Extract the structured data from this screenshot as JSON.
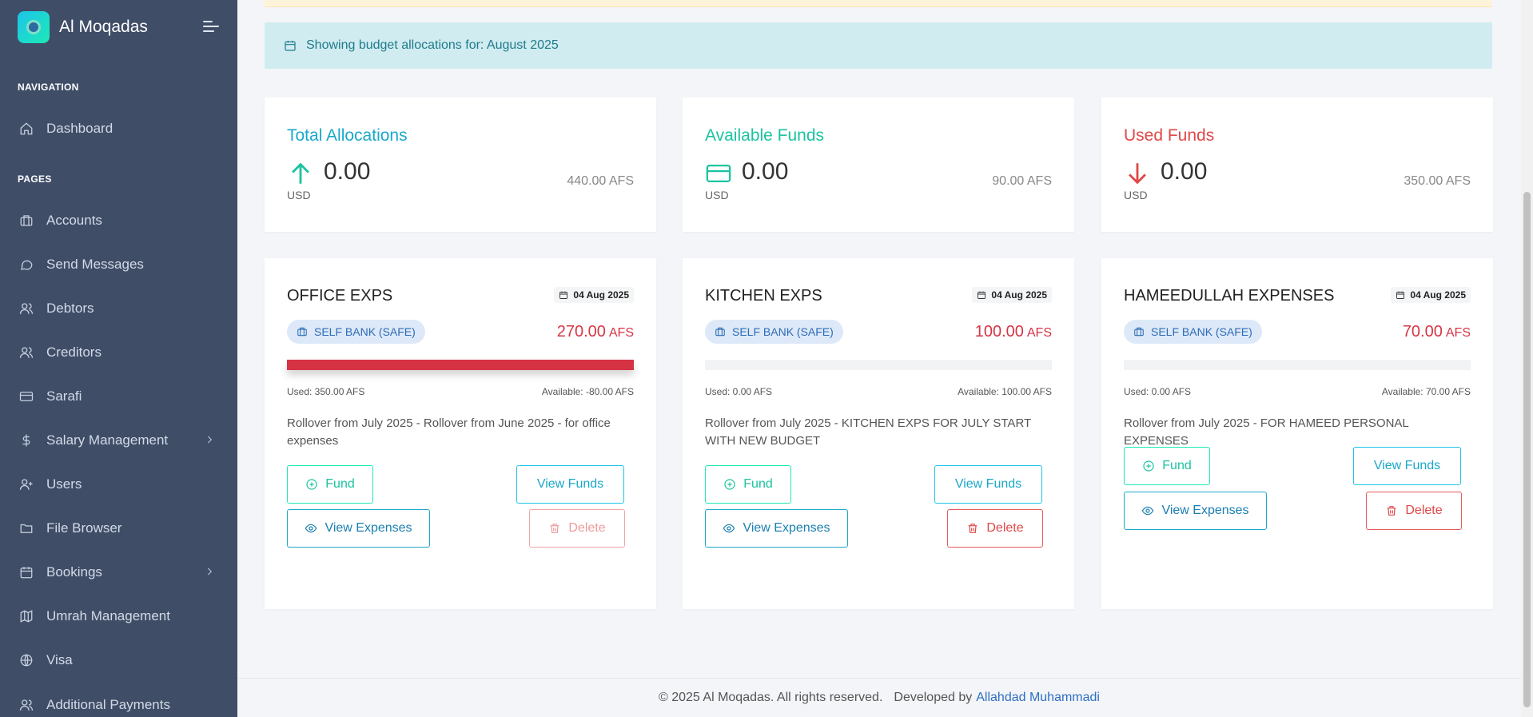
{
  "brand": {
    "name": "Al Moqadas"
  },
  "sidebar": {
    "captions": {
      "navigation": "NAVIGATION",
      "pages": "PAGES"
    },
    "items": [
      {
        "label": "Dashboard",
        "icon": "home-icon"
      },
      {
        "label": "Accounts",
        "icon": "briefcase-icon"
      },
      {
        "label": "Send Messages",
        "icon": "message-icon"
      },
      {
        "label": "Debtors",
        "icon": "users-icon"
      },
      {
        "label": "Creditors",
        "icon": "users-icon"
      },
      {
        "label": "Sarafi",
        "icon": "credit-card-icon"
      },
      {
        "label": "Salary Management",
        "icon": "dollar-icon",
        "submenu": true
      },
      {
        "label": "Users",
        "icon": "user-plus-icon"
      },
      {
        "label": "File Browser",
        "icon": "folder-icon"
      },
      {
        "label": "Bookings",
        "icon": "calendar-icon",
        "submenu": true
      },
      {
        "label": "Umrah Management",
        "icon": "map-icon"
      },
      {
        "label": "Visa",
        "icon": "globe-icon"
      },
      {
        "label": "Additional Payments",
        "icon": "users-icon"
      }
    ]
  },
  "info": {
    "text": "Showing budget allocations for: August 2025"
  },
  "stats": [
    {
      "title": "Total Allocations",
      "value": "0.00",
      "currency": "USD",
      "afs": "440.00 AFS",
      "color": "#1aa8c9",
      "icon": "arrow-up-icon"
    },
    {
      "title": "Available Funds",
      "value": "0.00",
      "currency": "USD",
      "afs": "90.00 AFS",
      "color": "#1bc3a0",
      "icon": "credit-card-icon"
    },
    {
      "title": "Used Funds",
      "value": "0.00",
      "currency": "USD",
      "afs": "350.00 AFS",
      "color": "#e04848",
      "icon": "arrow-down-icon"
    }
  ],
  "budgets": [
    {
      "name": "OFFICE EXPS",
      "date": "04 Aug 2025",
      "source": "SELF BANK (SAFE)",
      "amount": "270.00",
      "unit": "AFS",
      "used_fraction": 1.0,
      "used": "Used: 350.00 AFS",
      "available": "Available: -80.00 AFS",
      "description": "Rollover from July 2025 - Rollover from June 2025 - for office expenses"
    },
    {
      "name": "KITCHEN EXPS",
      "date": "04 Aug 2025",
      "source": "SELF BANK (SAFE)",
      "amount": "100.00",
      "unit": "AFS",
      "used_fraction": 0.0,
      "used": "Used: 0.00 AFS",
      "available": "Available: 100.00 AFS",
      "description": "Rollover from July 2025 - KITCHEN EXPS FOR JULY START WITH NEW BUDGET"
    },
    {
      "name": "HAMEEDULLAH EXPENSES",
      "date": "04 Aug 2025",
      "source": "SELF BANK (SAFE)",
      "amount": "70.00",
      "unit": "AFS",
      "used_fraction": 0.0,
      "used": "Used: 0.00 AFS",
      "available": "Available: 70.00 AFS",
      "description": "Rollover from July 2025 - FOR HAMEED PERSONAL EXPENSES"
    }
  ],
  "buttons": {
    "fund": "Fund",
    "view_funds": "View Funds",
    "view_expenses": "View Expenses",
    "delete": "Delete"
  },
  "footer": {
    "copyright": "© 2025 Al Moqadas. All rights reserved.",
    "developed_by": "Developed by",
    "developer": "Allahdad Muhammadi"
  }
}
